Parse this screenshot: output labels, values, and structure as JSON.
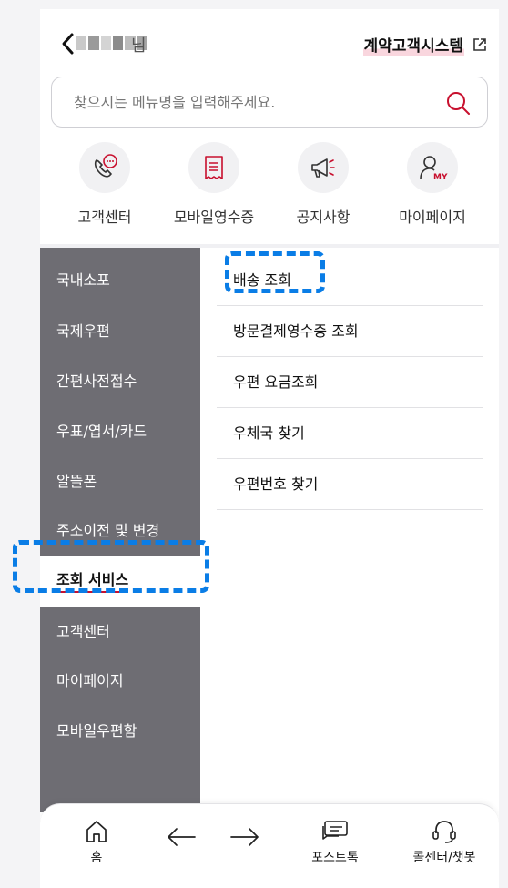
{
  "header": {
    "back_label": "<",
    "user_suffix": "님",
    "contract_link": "계약고객시스템"
  },
  "search": {
    "placeholder": "찾으시는 메뉴명을 입력해주세요."
  },
  "quick_links": [
    {
      "label": "고객센터",
      "icon": "headset-chat-icon"
    },
    {
      "label": "모바일영수증",
      "icon": "receipt-icon"
    },
    {
      "label": "공지사항",
      "icon": "megaphone-icon"
    },
    {
      "label": "마이페이지",
      "icon": "my-person-icon"
    }
  ],
  "sidebar": {
    "items": [
      {
        "label": "국내소포",
        "active": false
      },
      {
        "label": "국제우편",
        "active": false
      },
      {
        "label": "간편사전접수",
        "active": false
      },
      {
        "label": "우표/엽서/카드",
        "active": false
      },
      {
        "label": "알뜰폰",
        "active": false
      },
      {
        "label": "주소이전 및 변경",
        "active": false
      },
      {
        "label": "조회 서비스",
        "active": true
      },
      {
        "label": "고객센터",
        "active": false
      },
      {
        "label": "마이페이지",
        "active": false
      },
      {
        "label": "모바일우편함",
        "active": false
      }
    ]
  },
  "submenu": {
    "items": [
      {
        "label": "배송 조회"
      },
      {
        "label": "방문결제영수증 조회"
      },
      {
        "label": "우편 요금조회"
      },
      {
        "label": "우체국 찾기"
      },
      {
        "label": "우편번호 찾기"
      }
    ]
  },
  "bottom_nav": {
    "home": "홈",
    "posttalk": "포스트톡",
    "callcenter": "콜센터/챗봇"
  },
  "colors": {
    "accent": "#c8102e",
    "sidebar_bg": "#6e6d73",
    "highlight": "#0a7de6"
  }
}
